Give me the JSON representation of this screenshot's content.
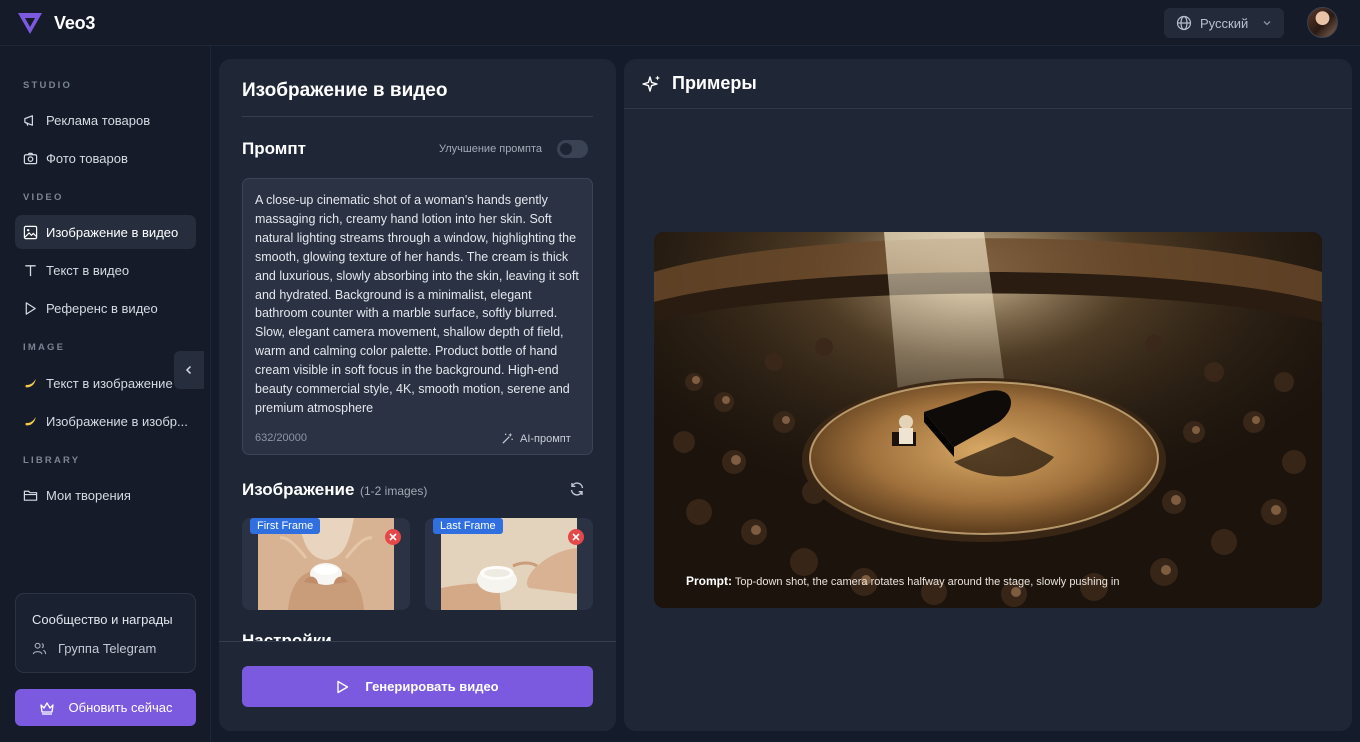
{
  "app": {
    "name": "Veo3"
  },
  "header": {
    "language": "Русский"
  },
  "sidebar": {
    "sections": {
      "studio": "STUDIO",
      "video": "VIDEO",
      "image": "IMAGE",
      "library": "LIBRARY"
    },
    "items": [
      {
        "label": "Реклама товаров",
        "icon": "megaphone-icon"
      },
      {
        "label": "Фото товаров",
        "icon": "camera-icon"
      },
      {
        "label": "Изображение в видео",
        "icon": "image-icon",
        "active": true
      },
      {
        "label": "Текст в видео",
        "icon": "text-icon"
      },
      {
        "label": "Референс в видео",
        "icon": "play-icon"
      },
      {
        "label": "Текст в изображение",
        "icon": "banana-icon"
      },
      {
        "label": "Изображение в изобр...",
        "icon": "banana-icon"
      },
      {
        "label": "Мои творения",
        "icon": "folder-icon"
      }
    ],
    "community": {
      "title": "Сообщество и награды",
      "link": "Группа Telegram"
    },
    "upgrade_label": "Обновить сейчас"
  },
  "editor": {
    "title": "Изображение в видео",
    "prompt": {
      "heading": "Промпт",
      "enhance_label": "Улучшение промпта",
      "enhance_enabled": false,
      "text": "A close-up cinematic shot of a woman's hands gently massaging rich, creamy hand lotion into her skin. Soft natural lighting streams through a window, highlighting the smooth, glowing texture of her hands. The cream is thick and luxurious, slowly absorbing into the skin, leaving it soft and hydrated. Background is a minimalist, elegant bathroom counter with a marble surface, softly blurred. Slow, elegant camera movement, shallow depth of field, warm and calming color palette. Product bottle of hand cream visible in soft focus in the background. High-end beauty commercial style, 4K, smooth motion, serene and premium atmosphere",
      "char_count": "632/20000",
      "ai_prompt_label": "AI-промпт"
    },
    "image": {
      "heading": "Изображение",
      "subheading": "(1-2 images)",
      "frames": [
        {
          "badge": "First Frame"
        },
        {
          "badge": "Last Frame"
        }
      ]
    },
    "settings_heading": "Настройки",
    "generate_label": "Генерировать видео"
  },
  "examples": {
    "title": "Примеры",
    "caption_label": "Prompt:",
    "caption_text": "Top-down shot, the camera rotates halfway around the stage, slowly pushing in"
  },
  "colors": {
    "accent": "#7c5ae0",
    "badge": "#2f6fe0",
    "remove": "#e54848",
    "background": "#141b2a",
    "panel": "#1f2737"
  }
}
